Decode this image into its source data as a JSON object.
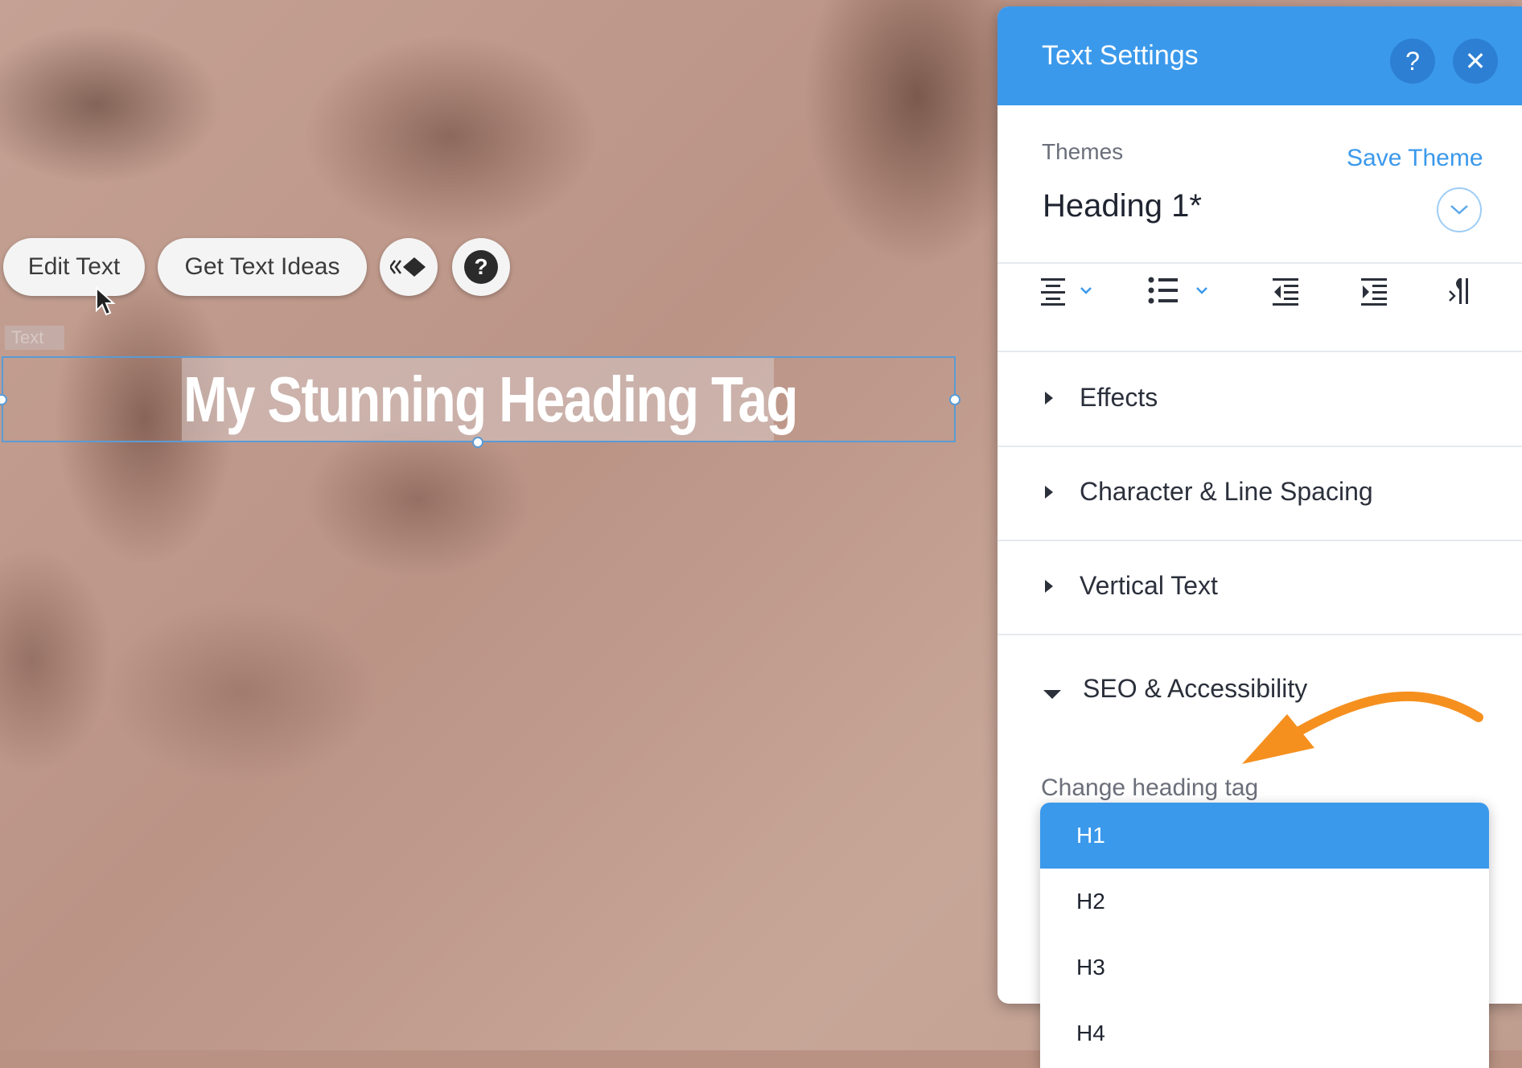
{
  "toolbar": {
    "edit_text": "Edit Text",
    "get_text_ideas": "Get Text Ideas",
    "help": "?"
  },
  "element_tag": "Text",
  "heading": {
    "text": "My Stunning Heading Tag"
  },
  "panel": {
    "title": "Text Settings",
    "help": "?",
    "close": "✕",
    "themes_label": "Themes",
    "save_theme": "Save Theme",
    "theme_value": "Heading 1*",
    "sections": {
      "effects": "Effects",
      "spacing": "Character & Line Spacing",
      "vertical": "Vertical Text",
      "seo": "SEO & Accessibility"
    },
    "change_heading_tag": "Change heading tag",
    "heading_tag_options": [
      "H1",
      "H2",
      "H3",
      "H4"
    ],
    "heading_tag_selected": "H1"
  },
  "colors": {
    "panel_header": "#3b99eb",
    "accent": "#3b99eb",
    "annotation_arrow": "#f5901f",
    "selection": "#5b9bd5"
  },
  "icons": [
    "align-center-icon",
    "list-icon",
    "indent-decrease-icon",
    "indent-increase-icon",
    "text-direction-icon",
    "chevron-down-icon",
    "caret-right-icon",
    "caret-down-icon",
    "animation-icon",
    "help-icon",
    "close-icon",
    "cursor-icon"
  ]
}
